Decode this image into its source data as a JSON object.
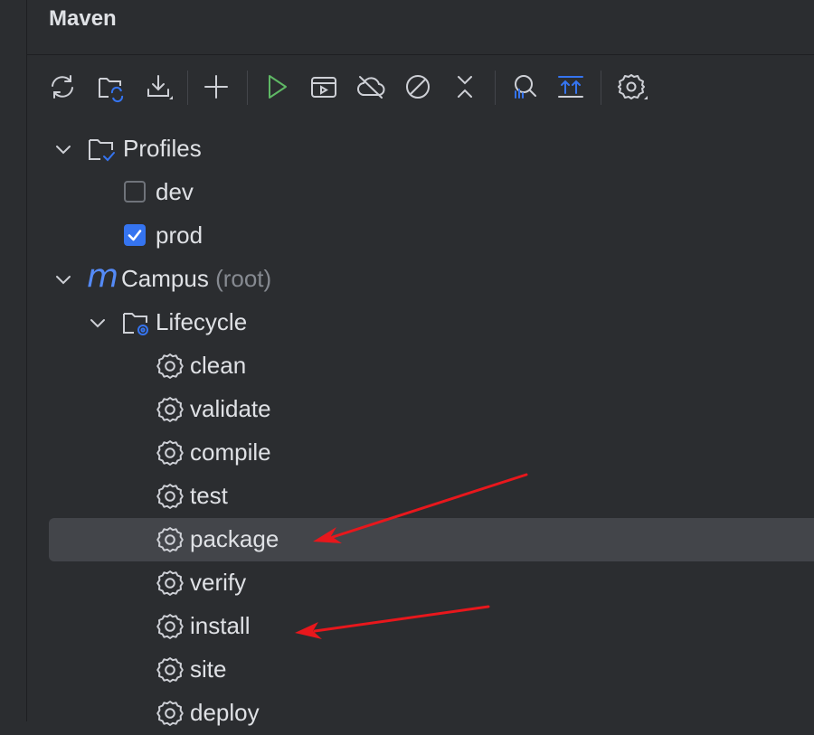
{
  "panel": {
    "title": "Maven"
  },
  "toolbar": {
    "buttons": [
      {
        "name": "reload-icon"
      },
      {
        "name": "generate-sources-icon"
      },
      {
        "name": "download-icon"
      },
      {
        "name": "add-icon"
      },
      {
        "name": "run-icon"
      },
      {
        "name": "execute-goal-icon"
      },
      {
        "name": "offline-mode-icon"
      },
      {
        "name": "skip-tests-icon"
      },
      {
        "name": "collapse-all-icon"
      },
      {
        "name": "analyze-dependencies-icon"
      },
      {
        "name": "expand-all-icon"
      },
      {
        "name": "settings-icon"
      }
    ]
  },
  "tree": {
    "profiles": {
      "label": "Profiles",
      "items": [
        {
          "label": "dev",
          "checked": false
        },
        {
          "label": "prod",
          "checked": true
        }
      ]
    },
    "project": {
      "icon": "m",
      "name": "Campus",
      "suffix": "(root)",
      "lifecycle": {
        "label": "Lifecycle",
        "goals": [
          "clean",
          "validate",
          "compile",
          "test",
          "package",
          "verify",
          "install",
          "site",
          "deploy"
        ],
        "selected": "package"
      }
    }
  },
  "annotations": {
    "arrow_color": "#e8171c",
    "pointing_at": [
      "package",
      "install"
    ]
  },
  "colors": {
    "background": "#2b2d30",
    "selection": "#43454a",
    "accent_blue": "#3574f0",
    "run_green": "#5fb865",
    "text": "#dfe1e5",
    "muted": "#868a91"
  }
}
